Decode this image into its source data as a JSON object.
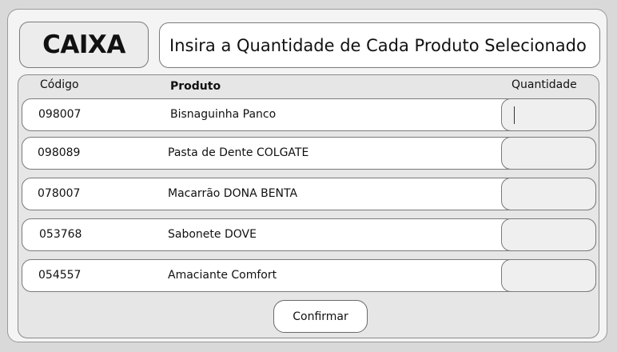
{
  "header": {
    "caixa_label": "CAIXA",
    "instruction": "Insira a Quantidade de Cada Produto Selecionado"
  },
  "table": {
    "columns": {
      "code": "Código",
      "product": "Produto",
      "quantity": "Quantidade"
    },
    "rows": [
      {
        "code": "098007",
        "product": "Bisnaguinha Panco",
        "quantity": ""
      },
      {
        "code": "098089",
        "product": "Pasta de Dente COLGATE",
        "quantity": ""
      },
      {
        "code": "078007",
        "product": "Macarrão DONA BENTA",
        "quantity": ""
      },
      {
        "code": "053768",
        "product": "Sabonete DOVE",
        "quantity": ""
      },
      {
        "code": "054557",
        "product": "Amaciante Comfort",
        "quantity": ""
      }
    ]
  },
  "actions": {
    "confirm_label": "Confirmar"
  }
}
